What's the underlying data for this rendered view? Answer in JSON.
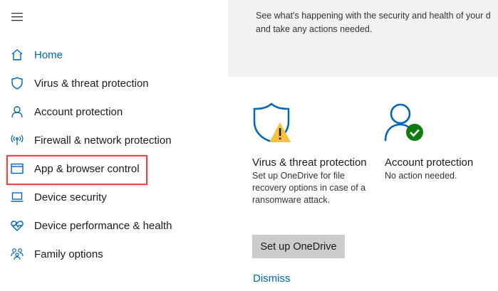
{
  "sidebar": {
    "menu_icon": "hamburger-icon",
    "items": [
      {
        "label": "Home",
        "icon": "home-icon"
      },
      {
        "label": "Virus & threat protection",
        "icon": "shield-icon"
      },
      {
        "label": "Account protection",
        "icon": "person-icon"
      },
      {
        "label": "Firewall & network protection",
        "icon": "antenna-icon"
      },
      {
        "label": "App & browser control",
        "icon": "browser-window-icon"
      },
      {
        "label": "Device security",
        "icon": "laptop-icon"
      },
      {
        "label": "Device performance & health",
        "icon": "heart-icon"
      },
      {
        "label": "Family options",
        "icon": "family-icon"
      }
    ]
  },
  "header": {
    "description": "See what's happening with the security and health of your d and take any actions needed."
  },
  "cards": {
    "virus": {
      "title": "Virus & threat protection",
      "description": "Set up OneDrive for file recovery options in case of a ransomware attack.",
      "button": "Set up OneDrive",
      "link": "Dismiss",
      "icon": "shield-warning-icon"
    },
    "account": {
      "title": "Account protection",
      "status": "No action needed.",
      "icon": "person-check-icon"
    }
  },
  "colors": {
    "accent": "#0067b8",
    "highlight": "#e04b4b",
    "ok": "#107c10",
    "warning": "#f6c23e"
  }
}
